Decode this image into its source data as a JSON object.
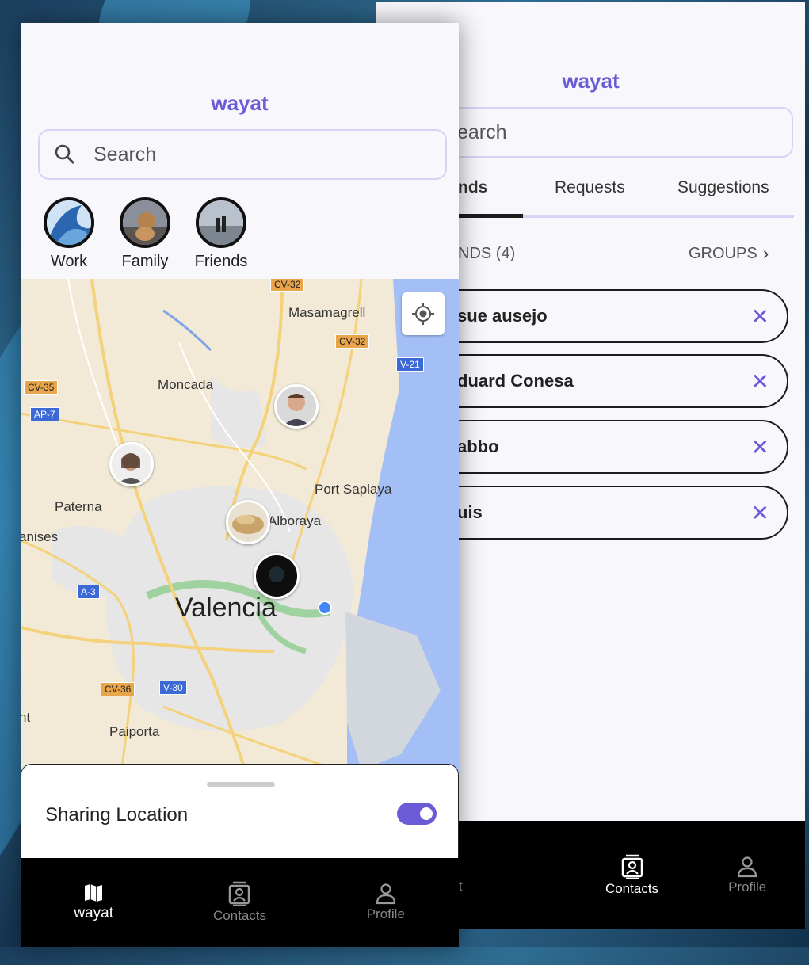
{
  "left_screen": {
    "app_title": "wayat",
    "search": {
      "placeholder": "Search"
    },
    "groups": [
      {
        "label": "Work"
      },
      {
        "label": "Family"
      },
      {
        "label": "Friends"
      }
    ],
    "map": {
      "places": [
        "Masamagrell",
        "Moncada",
        "Port Saplaya",
        "Paterna",
        "Alboraya",
        "anises",
        "Valencia",
        "Paiporta",
        "nt"
      ],
      "road_signs": [
        "CV-32",
        "CV-32",
        "V-21",
        "CV-35",
        "AP-7",
        "A-3",
        "CV-36",
        "V-30"
      ]
    },
    "sheet": {
      "label": "Sharing Location",
      "toggle_on": true
    },
    "navbar": [
      {
        "label": "wayat",
        "icon": "map-icon",
        "active": true
      },
      {
        "label": "Contacts",
        "icon": "contacts-icon",
        "active": false
      },
      {
        "label": "Profile",
        "icon": "profile-icon",
        "active": false
      }
    ]
  },
  "right_screen": {
    "app_title": "wayat",
    "search": {
      "visible_text": "earch"
    },
    "tabs": [
      {
        "label": "nds",
        "active": true
      },
      {
        "label": "Requests",
        "active": false
      },
      {
        "label": "Suggestions",
        "active": false
      }
    ],
    "friends_header": "NDS (4)",
    "groups_link": "GROUPS",
    "contacts": [
      {
        "name": "sue ausejo"
      },
      {
        "name": "duard Conesa"
      },
      {
        "name": "abbo"
      },
      {
        "name": "uis"
      }
    ],
    "navbar": [
      {
        "label": "t",
        "icon": "map-icon",
        "active": false
      },
      {
        "label": "Contacts",
        "icon": "contacts-icon",
        "active": true
      },
      {
        "label": "Profile",
        "icon": "profile-icon",
        "active": false
      }
    ]
  },
  "colors": {
    "accent": "#6b5bd6",
    "navbar": "#000000",
    "map_water": "#a4bff5"
  }
}
